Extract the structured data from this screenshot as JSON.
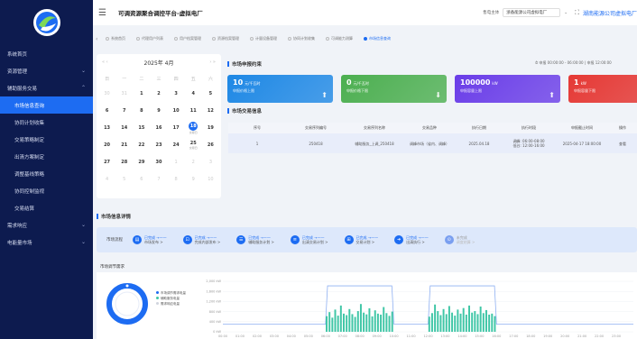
{
  "header": {
    "title": "可调资源聚合调控平台-虚拟电厂",
    "company_label": "售电主体",
    "company_value": "浙备能源公司虚拟电厂",
    "user": "湖南能源公司虚拟电厂"
  },
  "sidebar": {
    "items": [
      {
        "label": "系统首页",
        "arrow": ""
      },
      {
        "label": "资源管理",
        "arrow": "⌄"
      },
      {
        "label": "辅助服务交易",
        "arrow": "⌃"
      },
      {
        "label": "市场信息查询",
        "arrow": "",
        "sub": true,
        "active": true
      },
      {
        "label": "协同计划收集",
        "arrow": "",
        "sub": true
      },
      {
        "label": "交易策略制定",
        "arrow": "",
        "sub": true
      },
      {
        "label": "出清方案制定",
        "arrow": "",
        "sub": true
      },
      {
        "label": "调整基线策略",
        "arrow": "",
        "sub": true
      },
      {
        "label": "协同控制监视",
        "arrow": "",
        "sub": true
      },
      {
        "label": "交易结算",
        "arrow": "",
        "sub": true
      },
      {
        "label": "需求响应",
        "arrow": "⌄"
      },
      {
        "label": "电能量市场",
        "arrow": "⌄"
      }
    ]
  },
  "tabs": [
    {
      "label": "系统首页",
      "active": false
    },
    {
      "label": "代理用户列表",
      "active": false
    },
    {
      "label": "用户档案管理",
      "active": false
    },
    {
      "label": "资源档案管理",
      "active": false
    },
    {
      "label": "计量设备管理",
      "active": false
    },
    {
      "label": "协同计划收集",
      "active": false
    },
    {
      "label": "可调能力测算",
      "active": false
    },
    {
      "label": "市场信息查询",
      "active": true
    }
  ],
  "calendar": {
    "month": "2025年 4月",
    "weekdays": [
      "日",
      "一",
      "二",
      "三",
      "四",
      "五",
      "六"
    ],
    "days": [
      {
        "d": "30",
        "o": true
      },
      {
        "d": "31",
        "o": true
      },
      {
        "d": "1"
      },
      {
        "d": "2"
      },
      {
        "d": "3"
      },
      {
        "d": "4"
      },
      {
        "d": "5"
      },
      {
        "d": "6"
      },
      {
        "d": "7"
      },
      {
        "d": "8"
      },
      {
        "d": "9"
      },
      {
        "d": "10"
      },
      {
        "d": "11"
      },
      {
        "d": "12"
      },
      {
        "d": "13"
      },
      {
        "d": "14"
      },
      {
        "d": "15"
      },
      {
        "d": "16"
      },
      {
        "d": "17"
      },
      {
        "d": "18",
        "sel": true,
        "sub": "交易日"
      },
      {
        "d": "19"
      },
      {
        "d": "20"
      },
      {
        "d": "21"
      },
      {
        "d": "22"
      },
      {
        "d": "23"
      },
      {
        "d": "24"
      },
      {
        "d": "25",
        "sub": "交易日"
      },
      {
        "d": "26"
      },
      {
        "d": "27"
      },
      {
        "d": "28"
      },
      {
        "d": "29"
      },
      {
        "d": "30"
      },
      {
        "d": "1",
        "o": true
      },
      {
        "d": "2",
        "o": true
      },
      {
        "d": "3",
        "o": true
      },
      {
        "d": "4",
        "o": true
      },
      {
        "d": "5",
        "o": true
      },
      {
        "d": "6",
        "o": true
      },
      {
        "d": "7",
        "o": true
      },
      {
        "d": "8",
        "o": true
      },
      {
        "d": "9",
        "o": true
      },
      {
        "d": "10",
        "o": true
      }
    ]
  },
  "market": {
    "title": "市场申报约束",
    "time_range": "申报 00:00:00 - 06:00:00 | 申报 12:00:00",
    "cards": [
      {
        "value": "10",
        "unit": "元/千瓦时",
        "label": "申报价格上限",
        "color": "#1e88e5",
        "icon": "arrow-up-icon"
      },
      {
        "value": "0",
        "unit": "元/千瓦时",
        "label": "申报价格下限",
        "color": "#4caf50",
        "icon": "arrow-down-icon"
      },
      {
        "value": "100000",
        "unit": "kW",
        "label": "申报容量上限",
        "color": "#6a3de8",
        "icon": "arrow-up-icon"
      },
      {
        "value": "1",
        "unit": "kW",
        "label": "申报容量下限",
        "color": "#e53935",
        "icon": "arrow-up-icon"
      }
    ]
  },
  "trade": {
    "title": "市场交易信息",
    "columns": [
      "序号",
      "交易序列编号",
      "交易序列名称",
      "交易品种",
      "执行日期",
      "执行时段",
      "申报截止时间",
      "操作"
    ],
    "rows": [
      [
        "1",
        "250418",
        "辅助服务_上调_250418",
        "调峰市场（省内、调峰）",
        "2025.04.18",
        "调峰: 06:00-08:00\n低谷: 12:00-16:00",
        "2025-04-17 18:00:00",
        "查看"
      ]
    ]
  },
  "detail": {
    "title": "市场信息详情"
  },
  "flow": {
    "label": "市场流程",
    "steps": [
      {
        "status": "已完成",
        "name": "市场发布 >",
        "done": true
      },
      {
        "status": "已完成",
        "name": "完成内部发布 >",
        "done": true
      },
      {
        "status": "已完成",
        "name": "辅助服务计划 >",
        "done": true
      },
      {
        "status": "已完成",
        "name": "出清交易计划 >",
        "done": true
      },
      {
        "status": "已完成",
        "name": "交易计划 >",
        "done": true
      },
      {
        "status": "已完成",
        "name": "出清执行 >",
        "done": true
      },
      {
        "status": "未完成",
        "name": "调度结算 >",
        "done": false
      }
    ]
  },
  "demand": {
    "title": "市场调节需求",
    "legend": [
      {
        "label": "市场调节需求电量",
        "color": "#1d6cf2"
      },
      {
        "label": "辅助服务电量",
        "color": "#3fc6a6"
      },
      {
        "label": "需求响应电量",
        "color": "#d0d4de"
      }
    ]
  },
  "chart_data": {
    "type": "bar",
    "yticks": [
      "2,000 kW",
      "1,600 kW",
      "1,200 kW",
      "800 kW",
      "400 kW",
      "0 kW"
    ],
    "ylim": [
      0,
      2000
    ],
    "xticks": [
      "00:00",
      "01:00",
      "02:00",
      "03:00",
      "04:00",
      "05:00",
      "06:00",
      "07:00",
      "08:00",
      "09:00",
      "10:00",
      "11:00",
      "12:00",
      "13:00",
      "14:00",
      "15:00",
      "16:00",
      "17:00",
      "18:00",
      "19:00",
      "20:00",
      "21:00",
      "22:00",
      "23:00"
    ],
    "bars": [
      {
        "slot": 6,
        "v": [
          620,
          780,
          560,
          880,
          640,
          1040,
          720,
          660,
          900,
          700,
          590,
          820,
          1100,
          760,
          690,
          930,
          610,
          850,
          720,
          680,
          980,
          740,
          630,
          800
        ]
      },
      {
        "slot": 12,
        "v": [
          600,
          740,
          1080,
          820,
          660,
          900,
          700,
          1020,
          760,
          640,
          880,
          720,
          940,
          680,
          1040,
          760,
          820,
          700,
          1000,
          740,
          860,
          680,
          720,
          620
        ]
      }
    ],
    "line": {
      "base": 300,
      "high": 1820,
      "segments": [
        [
          6.0,
          10.0
        ],
        [
          12.0,
          16.0
        ]
      ]
    }
  }
}
